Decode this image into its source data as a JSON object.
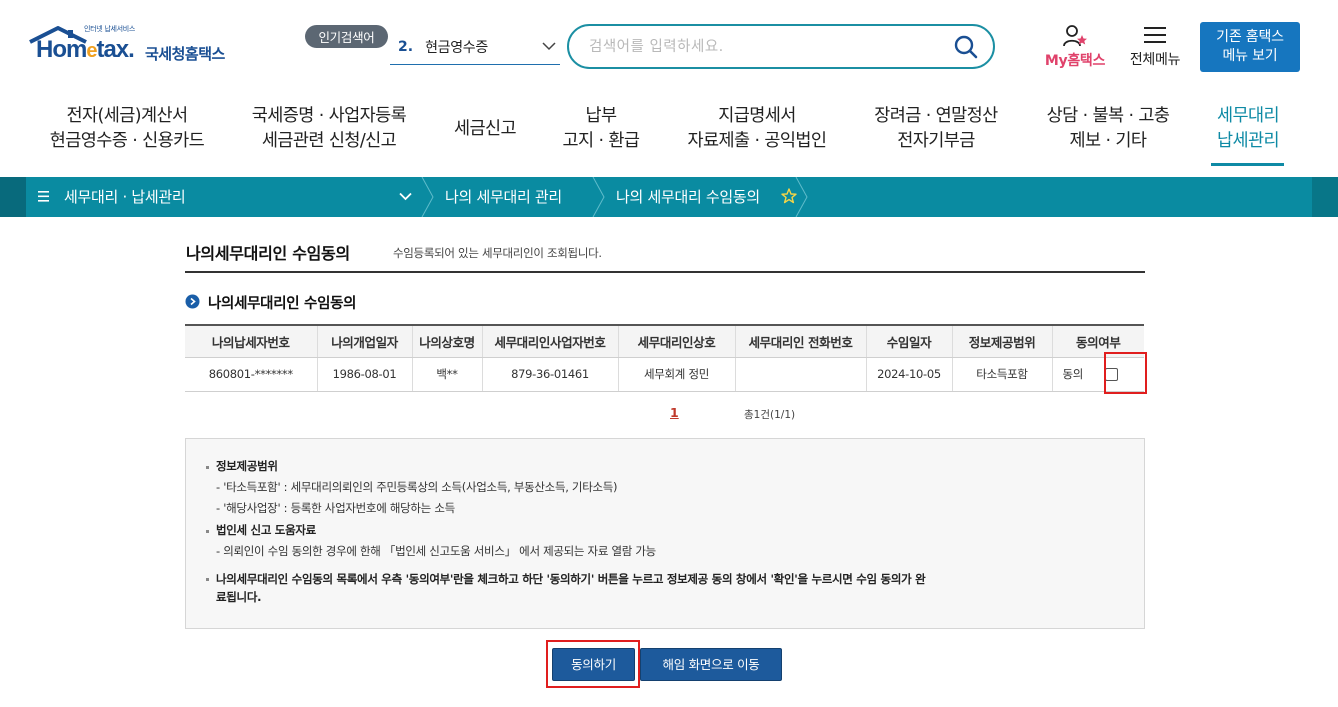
{
  "header": {
    "logo_sub": "인터넷 납세서비스",
    "logo_main_a": "Hom",
    "logo_main_e": "e",
    "logo_main_b": "tax.",
    "logo_kr": "국세청홈택스",
    "popular_badge": "인기검색어",
    "popular_rank": "2.",
    "popular_term": "현금영수증",
    "search_placeholder": "검색어를 입력하세요.",
    "my_hometax": "My홈택스",
    "all_menu": "전체메뉴",
    "legacy_line1": "기존 홈택스",
    "legacy_line2": "메뉴 보기"
  },
  "gnb": [
    {
      "line1": "전자(세금)계산서",
      "line2": "현금영수증 · 신용카드"
    },
    {
      "line1": "국세증명 · 사업자등록",
      "line2": "세금관련 신청/신고"
    },
    {
      "line1": "세금신고",
      "line2": ""
    },
    {
      "line1": "납부",
      "line2": "고지 · 환급"
    },
    {
      "line1": "지급명세서",
      "line2": "자료제출 · 공익법인"
    },
    {
      "line1": "장려금 · 연말정산",
      "line2": "전자기부금"
    },
    {
      "line1": "상담 · 불복 · 고충",
      "line2": "제보 · 기타"
    },
    {
      "line1": "세무대리",
      "line2": "납세관리"
    }
  ],
  "breadcrumb": {
    "menu": "세무대리 · 납세관리",
    "level2": "나의 세무대리 관리",
    "level3": "나의 세무대리 수임동의"
  },
  "page": {
    "title": "나의세무대리인 수임동의",
    "desc": "수임등록되어 있는 세무대리인이 조회됩니다.",
    "section_title": "나의세무대리인 수임동의"
  },
  "table": {
    "headers": [
      "나의납세자번호",
      "나의개업일자",
      "나의상호명",
      "세무대리인사업자번호",
      "세무대리인상호",
      "세무대리인 전화번호",
      "수임일자",
      "정보제공범위",
      "동의여부"
    ],
    "rows": [
      [
        "860801-*******",
        "1986-08-01",
        "백**",
        "879-36-01461",
        "세무회계 정민",
        "",
        "2024-10-05",
        "타소득포함",
        "동의"
      ]
    ]
  },
  "pager": {
    "current": "1",
    "total": "총1건(1/1)"
  },
  "info": {
    "h1": "정보제공범위",
    "l1": "- '타소득포함' : 세무대리의뢰인의 주민등록상의 소득(사업소득, 부동산소득, 기타소득)",
    "l2": "- '해당사업장' : 등록한 사업자번호에 해당하는 소득",
    "h2": "법인세 신고 도움자료",
    "l3": "- 의뢰인이 수임 동의한 경우에 한해 「법인세 신고도움 서비스」 에서 제공되는 자료 열람 가능",
    "h3a": "나의세무대리인 수임동의 목록에서 우측 '동의여부'란을 체크하고 하단 '동의하기' 버튼을 누르고 정보제공 동의 창에서 '확인'을 누르시면 수임 동의가 완",
    "h3b": "료됩니다."
  },
  "buttons": {
    "agree": "동의하기",
    "release": "해임 화면으로 이동"
  },
  "colors": {
    "brand_blue": "#1a4f93",
    "teal": "#0a8ba1",
    "highlight_red": "#e01e1e",
    "button_blue": "#1d5a9c"
  }
}
